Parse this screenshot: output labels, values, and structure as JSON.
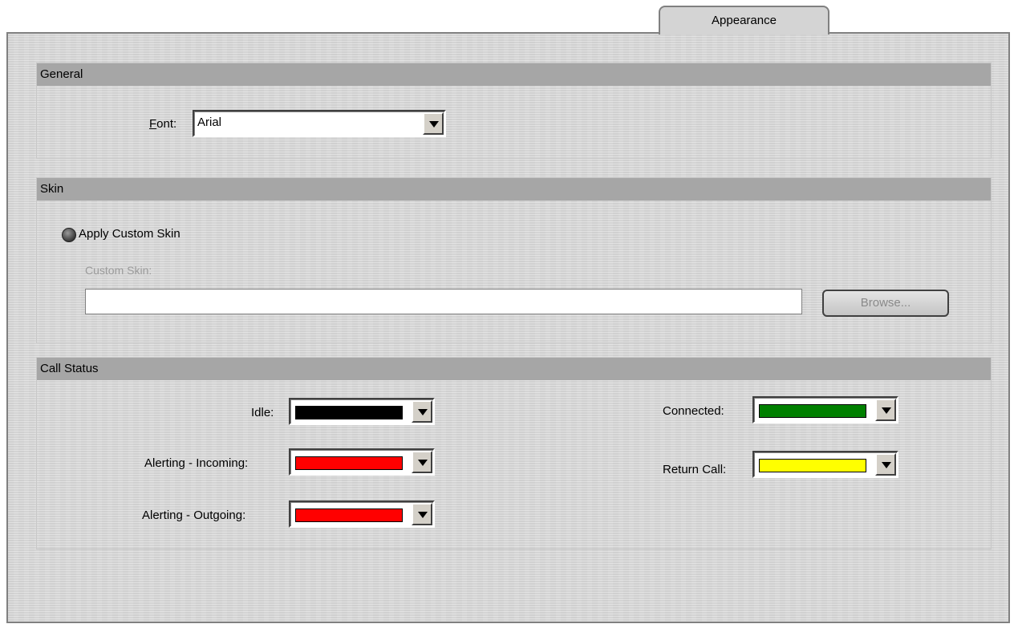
{
  "tab": {
    "label": "Appearance"
  },
  "general": {
    "header": "General",
    "font_label": "Font:",
    "font_value": "Arial"
  },
  "skin": {
    "header": "Skin",
    "apply_custom_skin": "Apply Custom Skin",
    "custom_skin_label": "Custom Skin:",
    "custom_skin_value": "",
    "browse_label": "Browse..."
  },
  "call_status": {
    "header": "Call Status",
    "idle": {
      "label": "Idle:",
      "color": "#000000"
    },
    "alerting_incoming": {
      "label": "Alerting - Incoming:",
      "color": "#ff0000"
    },
    "alerting_outgoing": {
      "label": "Alerting - Outgoing:",
      "color": "#ff0000"
    },
    "connected": {
      "label": "Connected:",
      "color": "#008000"
    },
    "return_call": {
      "label": "Return Call:",
      "color": "#ffff00"
    }
  },
  "icons": {
    "combo_arrow": "chevron-down-icon",
    "radio": "radio-button-icon"
  }
}
